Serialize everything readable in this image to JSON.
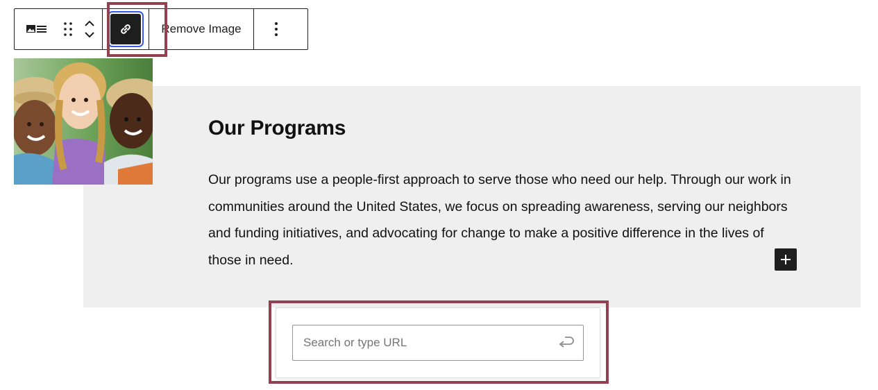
{
  "toolbar": {
    "block_type_icon": "media-text-icon",
    "drag_icon": "drag-handle-icon",
    "move_up_icon": "chevron-up-icon",
    "move_down_icon": "chevron-down-icon",
    "link_icon": "link-icon",
    "remove_image_label": "Remove Image",
    "more_icon": "more-vertical-icon"
  },
  "media_text": {
    "background_color": "#efefef",
    "heading": "Our Programs",
    "paragraph": "Our programs use a people-first approach to serve those who need our help. Through our work in communities around the United States, we focus on spreading awareness, serving our neighbors and funding initiatives, and advocating for change to make a positive difference in the lives of those in need.",
    "add_block_icon": "plus-icon"
  },
  "link_popover": {
    "url_placeholder": "Search or type URL",
    "url_value": "",
    "submit_icon": "enter-return-icon"
  },
  "colors": {
    "highlight_border": "#93414f",
    "active_button": "#1e1e1e",
    "focus_ring": "#3858e9"
  }
}
